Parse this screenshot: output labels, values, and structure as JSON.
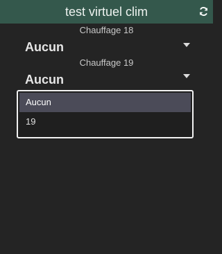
{
  "header": {
    "title": "test virtuel clim",
    "refresh_icon": "refresh-icon"
  },
  "fields": [
    {
      "label": "Chauffage 18",
      "value": "Aucun"
    },
    {
      "label": "Chauffage 19",
      "value": "Aucun"
    }
  ],
  "dropdown": {
    "options": [
      "Aucun",
      "19"
    ],
    "selected_index": 0
  },
  "colors": {
    "header_bg": "#34584c",
    "panel_bg": "#242424",
    "selected_option_bg": "#4b4b58"
  }
}
